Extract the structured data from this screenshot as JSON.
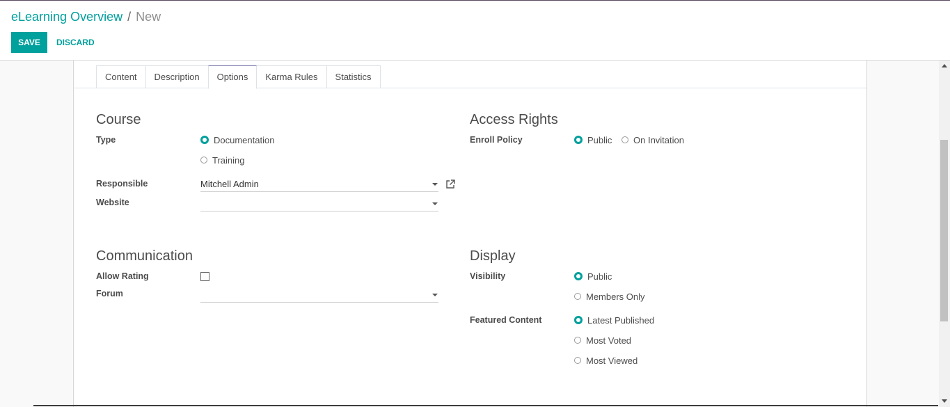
{
  "breadcrumb": {
    "parent": "eLearning Overview",
    "separator": "/",
    "current": "New"
  },
  "buttons": {
    "save": "SAVE",
    "discard": "DISCARD"
  },
  "tabs": [
    "Content",
    "Description",
    "Options",
    "Karma Rules",
    "Statistics"
  ],
  "active_tab": "Options",
  "course": {
    "title": "Course",
    "type_label": "Type",
    "type_options": [
      "Documentation",
      "Training"
    ],
    "type_selected": "Documentation",
    "responsible_label": "Responsible",
    "responsible_value": "Mitchell Admin",
    "website_label": "Website",
    "website_value": ""
  },
  "access": {
    "title": "Access Rights",
    "enroll_label": "Enroll Policy",
    "enroll_options": [
      "Public",
      "On Invitation"
    ],
    "enroll_selected": "Public"
  },
  "communication": {
    "title": "Communication",
    "rating_label": "Allow Rating",
    "rating_checked": false,
    "forum_label": "Forum",
    "forum_value": ""
  },
  "display": {
    "title": "Display",
    "visibility_label": "Visibility",
    "visibility_options": [
      "Public",
      "Members Only"
    ],
    "visibility_selected": "Public",
    "featured_label": "Featured Content",
    "featured_options": [
      "Latest Published",
      "Most Voted",
      "Most Viewed"
    ],
    "featured_selected": "Latest Published"
  },
  "colors": {
    "accent": "#00a09d",
    "tab_active_border": "#7c7bad"
  },
  "icons": {
    "external_link": "external-link-icon",
    "dropdown": "chevron-down-icon"
  }
}
